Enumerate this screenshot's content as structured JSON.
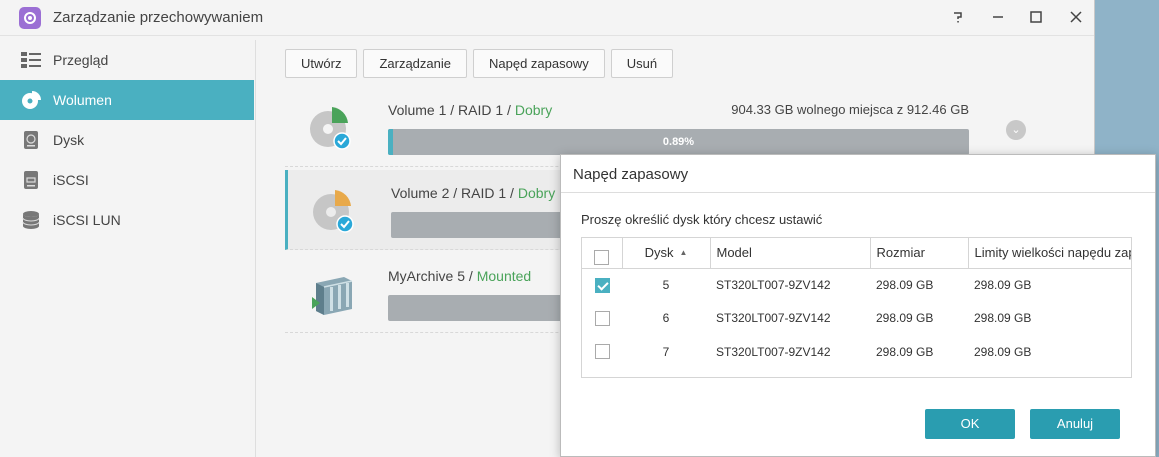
{
  "window": {
    "title": "Zarządzanie przechowywaniem"
  },
  "sidebar": {
    "items": [
      {
        "label": "Przegląd",
        "icon": "list-icon"
      },
      {
        "label": "Wolumen",
        "icon": "volume-icon"
      },
      {
        "label": "Dysk",
        "icon": "disk-icon"
      },
      {
        "label": "iSCSI",
        "icon": "iscsi-icon"
      },
      {
        "label": "iSCSI LUN",
        "icon": "database-icon"
      }
    ]
  },
  "toolbar": {
    "create": "Utwórz",
    "manage": "Zarządzanie",
    "spare": "Napęd zapasowy",
    "remove": "Usuń"
  },
  "volumes": [
    {
      "name": "Volume 1",
      "sep1": " / ",
      "raid": "RAID 1",
      "sep2": " / ",
      "status": "Dobry",
      "free": "904.33 GB wolnego miejsca z 912.46 GB",
      "usage_pct": "0.89%",
      "usage": 0.0089
    },
    {
      "name": "Volume 2",
      "sep1": " / ",
      "raid": "RAID 1",
      "sep2": " / ",
      "status": "Dobry"
    },
    {
      "name": "MyArchive 5",
      "sep1": " / ",
      "status": "Mounted"
    }
  ],
  "dialog": {
    "title": "Napęd zapasowy",
    "prompt": "Proszę określić dysk który chcesz ustawić",
    "columns": {
      "disk": "Dysk",
      "model": "Model",
      "size": "Rozmiar",
      "limit": "Limity wielkości napędu zap"
    },
    "rows": [
      {
        "checked": true,
        "disk": "5",
        "model": "ST320LT007-9ZV142",
        "size": "298.09 GB",
        "limit": "298.09 GB"
      },
      {
        "checked": false,
        "disk": "6",
        "model": "ST320LT007-9ZV142",
        "size": "298.09 GB",
        "limit": "298.09 GB"
      },
      {
        "checked": false,
        "disk": "7",
        "model": "ST320LT007-9ZV142",
        "size": "298.09 GB",
        "limit": "298.09 GB"
      }
    ],
    "ok": "OK",
    "cancel": "Anuluj"
  },
  "colors": {
    "accent": "#4ab0c1",
    "status_good": "#4aa35a",
    "button": "#2a9db0",
    "app_icon": "#9b6fd4"
  }
}
